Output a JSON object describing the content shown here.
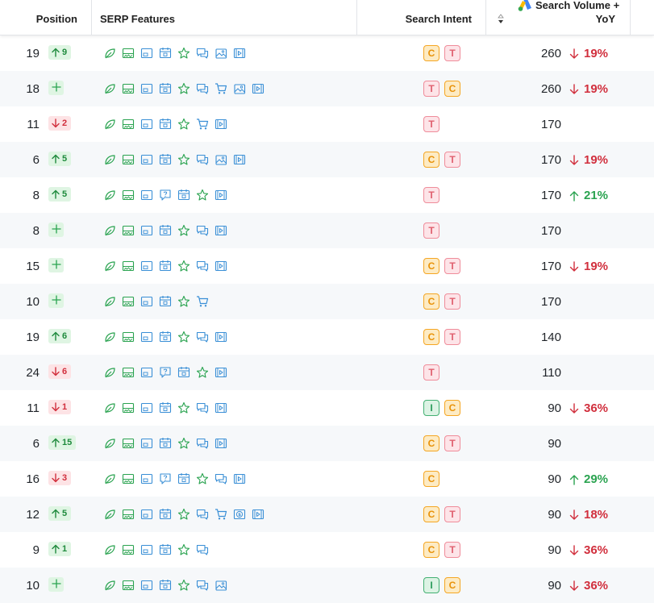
{
  "header": {
    "position": "Position",
    "serp": "SERP Features",
    "intent": "Search Intent",
    "volume_line1": "Search Volume +",
    "volume_line2": "YoY",
    "logo_icon": "google-ads-icon",
    "sort_icon": "sort-icon"
  },
  "colors": {
    "green": "#2aa350",
    "red": "#d12f3d",
    "blue": "#3a8fd6",
    "intent_commercial": "#f5a623",
    "intent_transactional": "#ef8c9a",
    "intent_informational": "#43b072"
  },
  "rows": [
    {
      "position": "19",
      "change": {
        "dir": "up",
        "value": "9"
      },
      "features": [
        "leaf",
        "image-pack",
        "image",
        "calendar",
        "star",
        "reviews",
        "image-gallery",
        "video"
      ],
      "intents": [
        "C",
        "T"
      ],
      "volume": "260",
      "yoy": {
        "dir": "down",
        "value": "19%"
      }
    },
    {
      "position": "18",
      "change": {
        "dir": "new",
        "value": "+"
      },
      "features": [
        "leaf",
        "image-pack",
        "image",
        "calendar",
        "star",
        "reviews",
        "cart",
        "image-gallery",
        "video"
      ],
      "intents": [
        "T",
        "C"
      ],
      "volume": "260",
      "yoy": {
        "dir": "down",
        "value": "19%"
      }
    },
    {
      "position": "11",
      "change": {
        "dir": "down",
        "value": "2"
      },
      "features": [
        "leaf",
        "image-pack",
        "image",
        "calendar",
        "star",
        "cart",
        "video"
      ],
      "intents": [
        "T"
      ],
      "volume": "170",
      "yoy": null
    },
    {
      "position": "6",
      "change": {
        "dir": "up",
        "value": "5"
      },
      "features": [
        "leaf",
        "image-pack",
        "image",
        "calendar",
        "star",
        "reviews",
        "image-gallery",
        "video"
      ],
      "intents": [
        "C",
        "T"
      ],
      "volume": "170",
      "yoy": {
        "dir": "down",
        "value": "19%"
      }
    },
    {
      "position": "8",
      "change": {
        "dir": "up",
        "value": "5"
      },
      "features": [
        "leaf",
        "image-pack",
        "image",
        "faq",
        "calendar",
        "star",
        "video"
      ],
      "intents": [
        "T"
      ],
      "volume": "170",
      "yoy": {
        "dir": "up",
        "value": "21%"
      }
    },
    {
      "position": "8",
      "change": {
        "dir": "new",
        "value": "+"
      },
      "features": [
        "leaf",
        "image-pack",
        "image",
        "calendar",
        "star",
        "reviews",
        "video"
      ],
      "intents": [
        "T"
      ],
      "volume": "170",
      "yoy": null
    },
    {
      "position": "15",
      "change": {
        "dir": "new",
        "value": "+"
      },
      "features": [
        "leaf",
        "image-pack",
        "image",
        "calendar",
        "star",
        "reviews",
        "video"
      ],
      "intents": [
        "C",
        "T"
      ],
      "volume": "170",
      "yoy": {
        "dir": "down",
        "value": "19%"
      }
    },
    {
      "position": "10",
      "change": {
        "dir": "new",
        "value": "+"
      },
      "features": [
        "leaf",
        "image-pack",
        "image",
        "calendar",
        "star",
        "cart"
      ],
      "intents": [
        "C",
        "T"
      ],
      "volume": "170",
      "yoy": null
    },
    {
      "position": "19",
      "change": {
        "dir": "up",
        "value": "6"
      },
      "features": [
        "leaf",
        "image-pack",
        "image",
        "calendar",
        "star",
        "reviews",
        "video"
      ],
      "intents": [
        "C",
        "T"
      ],
      "volume": "140",
      "yoy": null
    },
    {
      "position": "24",
      "change": {
        "dir": "down",
        "value": "6"
      },
      "features": [
        "leaf",
        "image-pack",
        "image",
        "faq",
        "calendar",
        "star",
        "video"
      ],
      "intents": [
        "T"
      ],
      "volume": "110",
      "yoy": null
    },
    {
      "position": "11",
      "change": {
        "dir": "down",
        "value": "1"
      },
      "features": [
        "leaf",
        "image-pack",
        "image",
        "calendar",
        "star",
        "reviews",
        "video"
      ],
      "intents": [
        "I",
        "C"
      ],
      "volume": "90",
      "yoy": {
        "dir": "down",
        "value": "36%"
      }
    },
    {
      "position": "6",
      "change": {
        "dir": "up",
        "value": "15"
      },
      "features": [
        "leaf",
        "image-pack",
        "image",
        "calendar",
        "star",
        "reviews",
        "video"
      ],
      "intents": [
        "C",
        "T"
      ],
      "volume": "90",
      "yoy": null
    },
    {
      "position": "16",
      "change": {
        "dir": "down",
        "value": "3"
      },
      "features": [
        "leaf",
        "image-pack",
        "image",
        "faq",
        "calendar",
        "star",
        "reviews",
        "video"
      ],
      "intents": [
        "C"
      ],
      "volume": "90",
      "yoy": {
        "dir": "up",
        "value": "29%"
      }
    },
    {
      "position": "12",
      "change": {
        "dir": "up",
        "value": "5"
      },
      "features": [
        "leaf",
        "image-pack",
        "image",
        "calendar",
        "star",
        "reviews",
        "cart",
        "price",
        "video"
      ],
      "intents": [
        "C",
        "T"
      ],
      "volume": "90",
      "yoy": {
        "dir": "down",
        "value": "18%"
      }
    },
    {
      "position": "9",
      "change": {
        "dir": "up",
        "value": "1"
      },
      "features": [
        "leaf",
        "image-pack",
        "image",
        "calendar",
        "star",
        "reviews"
      ],
      "intents": [
        "C",
        "T"
      ],
      "volume": "90",
      "yoy": {
        "dir": "down",
        "value": "36%"
      }
    },
    {
      "position": "10",
      "change": {
        "dir": "new",
        "value": "+"
      },
      "features": [
        "leaf",
        "image-pack",
        "image",
        "calendar",
        "star",
        "reviews",
        "image-gallery"
      ],
      "intents": [
        "I",
        "C"
      ],
      "volume": "90",
      "yoy": {
        "dir": "down",
        "value": "36%"
      }
    }
  ]
}
